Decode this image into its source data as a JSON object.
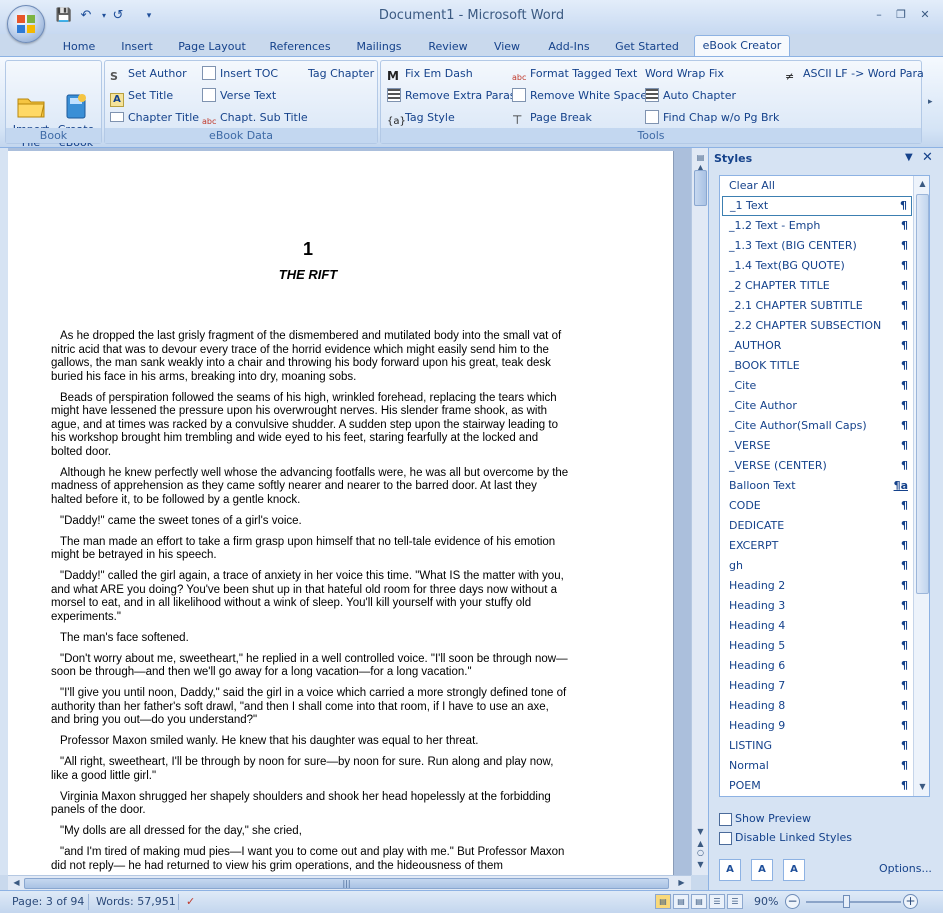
{
  "window": {
    "title": "Document1 - Microsoft Word",
    "controls": [
      "minimize-icon",
      "restore-icon",
      "close-icon"
    ]
  },
  "quick_access": [
    "save-icon",
    "undo-icon",
    "redo-icon",
    "customize-icon"
  ],
  "tabs": [
    "Home",
    "Insert",
    "Page Layout",
    "References",
    "Mailings",
    "Review",
    "View",
    "Add-Ins",
    "Get Started",
    "eBook Creator"
  ],
  "active_tab": "eBook Creator",
  "ribbon": {
    "book": {
      "label": "Book",
      "import": "Import\nFile",
      "create": "Create\neBook"
    },
    "ebook_data": {
      "label": "eBook Data",
      "set_author": "Set Author",
      "insert_toc": "Insert TOC",
      "tag_chapter": "Tag Chapter",
      "set_title": "Set Title",
      "verse_text": "Verse Text",
      "chapter_title": "Chapter Title",
      "chapt_sub_title": "Chapt. Sub Title"
    },
    "tools": {
      "label": "Tools",
      "fix_em_dash": "Fix Em Dash",
      "format_tagged": "Format Tagged Text",
      "word_wrap": "Word Wrap Fix",
      "ascii_lf": "ASCII LF -> Word Para",
      "remove_extra": "Remove Extra Paras",
      "remove_white": "Remove White Space",
      "auto_chapter": "Auto Chapter",
      "tag_style": "Tag Style",
      "page_break": "Page Break",
      "find_chap": "Find Chap w/o Pg Brk"
    }
  },
  "document": {
    "chapter_number": "1",
    "chapter_title": "THE RIFT",
    "paragraphs": [
      "As he dropped the last grisly fragment of the dismembered and mutilated body into the small vat of nitric acid that was to devour every trace of the horrid evidence which might easily send him to the gallows, the man sank weakly into a chair and throwing his body forward upon his great, teak desk buried his face in his arms, breaking into dry, moaning sobs.",
      "Beads of perspiration followed the seams of his high, wrinkled forehead, replacing the tears which might have lessened the pressure upon his overwrought nerves.  His slender frame shook, as with ague, and at times was racked by a convulsive shudder.  A sudden step upon the stairway leading to his workshop brought him trembling and wide eyed to his feet, staring fearfully at the locked and bolted door.",
      "Although he knew perfectly well whose the advancing footfalls were, he was all but overcome by the madness of apprehension as they came softly nearer and nearer to the barred door.  At last they halted before it, to be followed by a gentle knock.",
      "\"Daddy!\" came the sweet tones of a girl's voice.",
      "The man made an effort to take a firm grasp upon himself that no tell-tale evidence of his emotion might be betrayed in his speech.",
      "\"Daddy!\" called the girl again, a trace of anxiety in her voice this time.  \"What IS the matter with you, and what ARE you doing?  You've been shut up in that hateful old room for three days now without a morsel to eat, and in all likelihood without a wink of sleep.  You'll kill yourself with your stuffy old experiments.\"",
      "The man's face softened.",
      "\"Don't worry about me, sweetheart,\" he replied in a well controlled voice.  \"I'll soon be through now—soon be through—and then we'll go away for a long vacation—for a long vacation.\"",
      "\"I'll give you until noon, Daddy,\" said the girl in a voice which carried a more strongly defined tone of authority than her father's soft drawl, \"and then I  shall come into that room, if I  have to  use an axe, and bring you out—do you understand?\"",
      "Professor Maxon smiled wanly.  He knew that his daughter was equal to her threat.",
      "\"All right, sweetheart, I'll be through by noon for sure—by noon for sure.  Run along and play now, like a good little girl.\"",
      "Virginia Maxon shrugged her shapely shoulders and shook her head hopelessly at the forbidding panels of the door.",
      "\"My dolls are all dressed for the day,\" she cried,",
      "\"and I'm tired of making mud pies—I want you to  come out and play with me.\"  But Professor Maxon did not reply— he had returned to view his grim operations, and the hideousness of them"
    ]
  },
  "styles_pane": {
    "title": "Styles",
    "items": [
      "Clear All",
      "_1 Text",
      "_1.2 Text - Emph",
      "_1.3 Text (BIG CENTER)",
      "_1.4 Text(BG QUOTE)",
      "_2 CHAPTER TITLE",
      "_2.1 CHAPTER SUBTITLE",
      "_2.2 CHAPTER SUBSECTION",
      "_AUTHOR",
      "_BOOK TITLE",
      "_Cite",
      "_Cite Author",
      "_Cite Author(Small Caps)",
      "_VERSE",
      "_VERSE (CENTER)",
      "Balloon Text",
      "CODE",
      "DEDICATE",
      "EXCERPT",
      "gh",
      "Heading 2",
      "Heading 3",
      "Heading 4",
      "Heading 5",
      "Heading 6",
      "Heading 7",
      "Heading 8",
      "Heading 9",
      "LISTING",
      "Normal",
      "POEM"
    ],
    "selected": "_1 Text",
    "pilcrow": "¶",
    "linked_mark": "¶a",
    "show_preview": "Show Preview",
    "disable_linked": "Disable Linked Styles",
    "options": "Options..."
  },
  "status": {
    "page": "Page: 3 of 94",
    "words": "Words: 57,951",
    "zoom": "90%",
    "zoom_level_percent": 90
  },
  "colors": {
    "accent": "#15428b",
    "ribbon": "#d5e4f6",
    "selection": "#3c7fb1"
  }
}
